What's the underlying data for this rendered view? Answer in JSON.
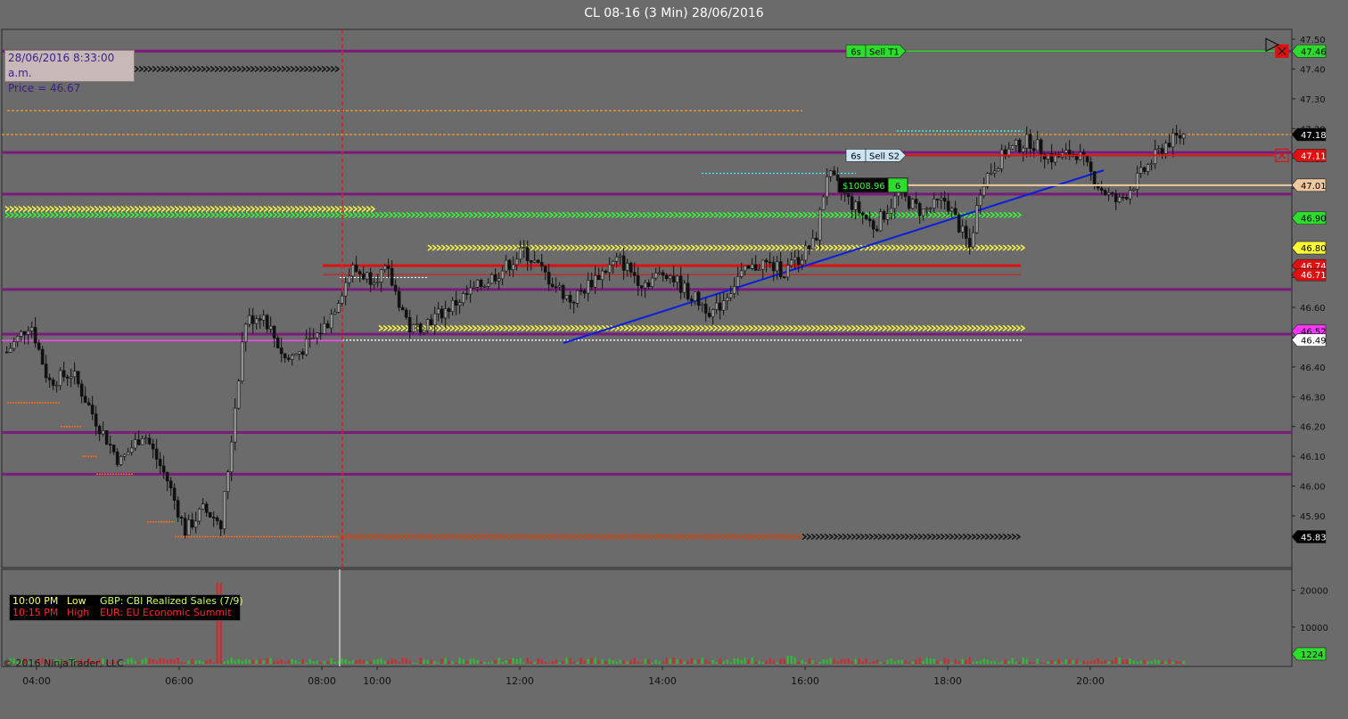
{
  "window": {
    "title": "CL 08-16 (3 Min)  28/06/2016"
  },
  "info_box": {
    "line1": "28/06/2016 8:33:00 a.m.",
    "line2": "Price = 46.67"
  },
  "events": [
    {
      "time": "10:00 PM",
      "impact": "Low",
      "name": "GBP: CBI Realized Sales (7/9)",
      "color": "#ffff66"
    },
    {
      "time": "10:15 PM",
      "impact": "High",
      "name": "EUR: EU Economic Summit",
      "color": "#ff2a2a"
    }
  ],
  "copyright": "© 2016 NinjaTrader, LLC",
  "orders": {
    "target": {
      "qty": "6s",
      "label": "Sell T1",
      "price": 47.46
    },
    "stop": {
      "qty": "6s",
      "label": "Sell S2",
      "price": 47.11
    },
    "position": {
      "pnl": "$1008.96",
      "qty": "6",
      "price": 47.01
    }
  },
  "colors": {
    "background": "#6b6b6b",
    "panel_bg": "#6b6b6b",
    "purple_level": "#7a1a7a",
    "stop_red": "#e01010",
    "target_green": "#2ddc2d",
    "trend_blue": "#0a1edc",
    "cursor_red": "#e02020",
    "volume_up": "#22cc22",
    "volume_down": "#dd2222"
  },
  "chart_data": [
    {
      "type": "candlestick",
      "title": "CL 08-16 (3 Min)  28/06/2016",
      "x_ticks": [
        "04:00",
        "06:00",
        "08:00",
        "10:00",
        "12:00",
        "14:00",
        "16:00",
        "18:00",
        "20:00"
      ],
      "y_ticks": [
        45.9,
        46.0,
        46.1,
        46.2,
        46.3,
        46.4,
        46.5,
        46.6,
        46.7,
        46.8,
        46.9,
        47.0,
        47.1,
        47.2,
        47.3,
        47.4,
        47.5
      ],
      "ylim": [
        45.8,
        47.52
      ],
      "price_path": [
        [
          "03:35",
          46.45
        ],
        [
          "03:55",
          46.55
        ],
        [
          "04:10",
          46.35
        ],
        [
          "04:30",
          46.38
        ],
        [
          "04:50",
          46.22
        ],
        [
          "05:10",
          46.08
        ],
        [
          "05:30",
          46.18
        ],
        [
          "05:50",
          46.02
        ],
        [
          "06:05",
          45.85
        ],
        [
          "06:20",
          45.92
        ],
        [
          "06:35",
          45.88
        ],
        [
          "06:40",
          46.02
        ],
        [
          "06:55",
          46.55
        ],
        [
          "07:10",
          46.58
        ],
        [
          "07:30",
          46.42
        ],
        [
          "07:50",
          46.48
        ],
        [
          "08:05",
          46.55
        ],
        [
          "08:25",
          46.73
        ],
        [
          "08:40",
          46.7
        ],
        [
          "08:55",
          46.72
        ],
        [
          "09:15",
          46.52
        ],
        [
          "09:40",
          46.58
        ],
        [
          "10:05",
          46.65
        ],
        [
          "10:30",
          46.72
        ],
        [
          "10:50",
          46.79
        ],
        [
          "11:10",
          46.7
        ],
        [
          "11:30",
          46.62
        ],
        [
          "11:50",
          46.7
        ],
        [
          "12:10",
          46.76
        ],
        [
          "12:30",
          46.68
        ],
        [
          "12:50",
          46.72
        ],
        [
          "13:10",
          46.64
        ],
        [
          "13:30",
          46.58
        ],
        [
          "13:50",
          46.7
        ],
        [
          "14:10",
          46.75
        ],
        [
          "14:30",
          46.72
        ],
        [
          "14:55",
          46.82
        ],
        [
          "15:05",
          47.05
        ],
        [
          "15:25",
          46.95
        ],
        [
          "15:45",
          46.87
        ],
        [
          "16:05",
          46.98
        ],
        [
          "16:25",
          46.92
        ],
        [
          "16:45",
          46.96
        ],
        [
          "17:05",
          46.8
        ],
        [
          "17:15",
          47.02
        ],
        [
          "17:35",
          47.12
        ],
        [
          "17:55",
          47.16
        ],
        [
          "18:15",
          47.1
        ],
        [
          "18:35",
          47.12
        ],
        [
          "18:55",
          47.0
        ],
        [
          "19:10",
          46.95
        ],
        [
          "19:30",
          47.05
        ],
        [
          "19:50",
          47.15
        ],
        [
          "20:05",
          47.18
        ]
      ],
      "price_markers": [
        {
          "value": 47.46,
          "label": "47.46",
          "bg": "#2ddc2d",
          "fg": "#000000"
        },
        {
          "value": 47.18,
          "label": "47.18",
          "bg": "#000000",
          "fg": "#ffffff"
        },
        {
          "value": 47.11,
          "label": "47.11",
          "bg": "#e01010",
          "fg": "#ffffff"
        },
        {
          "value": 47.01,
          "label": "47.01",
          "bg": "#f0c8a0",
          "fg": "#000000"
        },
        {
          "value": 46.9,
          "label": "46.90",
          "bg": "#2ddc2d",
          "fg": "#000000"
        },
        {
          "value": 46.8,
          "label": "46.80",
          "bg": "#ffff33",
          "fg": "#000000"
        },
        {
          "value": 46.74,
          "label": "46.74",
          "bg": "#e01010",
          "fg": "#ffffff"
        },
        {
          "value": 46.71,
          "label": "46.71",
          "bg": "#e01010",
          "fg": "#ffffff"
        },
        {
          "value": 46.52,
          "label": "46.52",
          "bg": "#ff33ff",
          "fg": "#000000"
        },
        {
          "value": 46.49,
          "label": "46.49",
          "bg": "#ffffff",
          "fg": "#000000"
        },
        {
          "value": 45.83,
          "label": "45.83",
          "bg": "#000000",
          "fg": "#ffffff"
        }
      ],
      "levels": [
        {
          "value": 47.46,
          "style": "purple"
        },
        {
          "value": 47.12,
          "style": "purple"
        },
        {
          "value": 46.98,
          "style": "purple"
        },
        {
          "value": 46.66,
          "style": "purple"
        },
        {
          "value": 46.51,
          "style": "purple"
        },
        {
          "value": 46.18,
          "style": "purple"
        },
        {
          "value": 46.04,
          "style": "purple"
        }
      ]
    },
    {
      "type": "bar",
      "title": "",
      "y_ticks": [
        10000,
        20000
      ],
      "ylim": [
        0,
        25000
      ],
      "last_value_label": "1224"
    }
  ]
}
